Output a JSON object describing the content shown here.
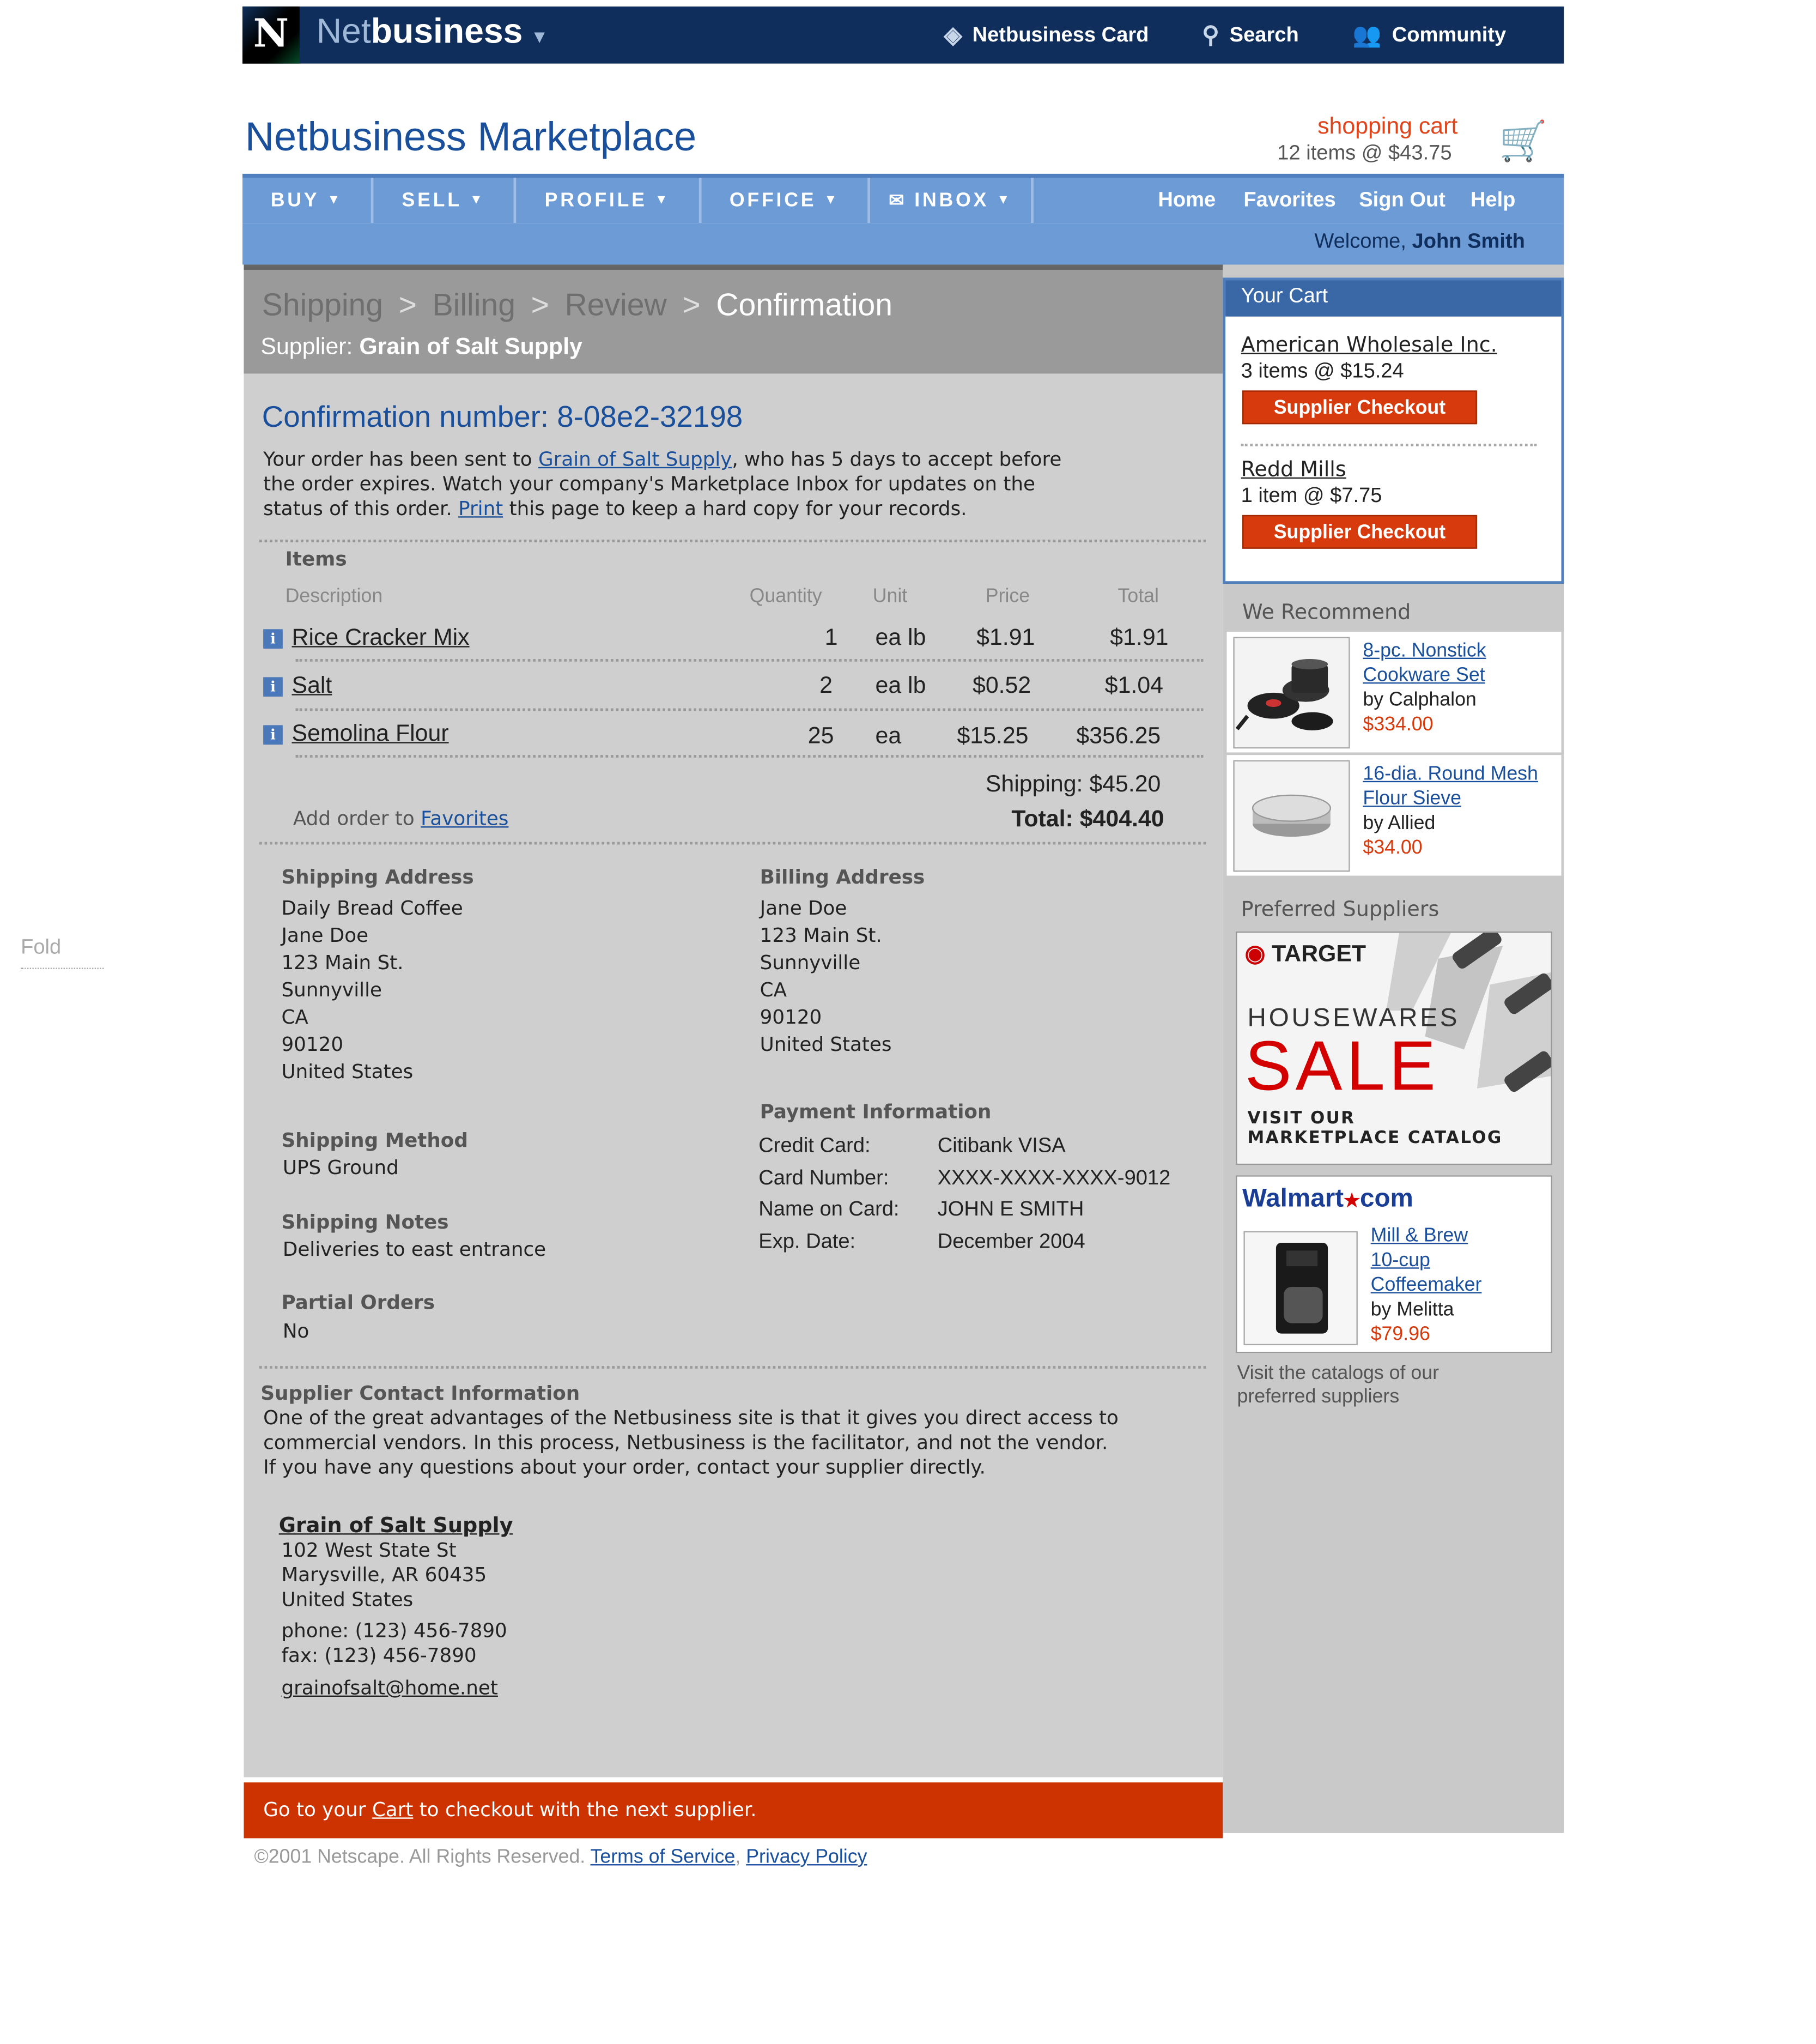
{
  "topbar": {
    "logo_letter": "N",
    "brand_light": "Net",
    "brand_bold": "business",
    "links": [
      {
        "label": "Netbusiness Card",
        "icon": "card-icon"
      },
      {
        "label": "Search",
        "icon": "search-icon"
      },
      {
        "label": "Community",
        "icon": "community-icon"
      }
    ]
  },
  "header": {
    "title": "Netbusiness Marketplace",
    "cart_label": "shopping cart",
    "cart_summary": "12 items @ $43.75"
  },
  "nav": {
    "tabs": [
      "BUY",
      "SELL",
      "PROFILE",
      "OFFICE",
      "INBOX"
    ],
    "right_links": [
      "Home",
      "Favorites",
      "Sign Out",
      "Help"
    ],
    "welcome_prefix": "Welcome,",
    "welcome_name": "John Smith"
  },
  "steps": {
    "items": [
      "Shipping",
      "Billing",
      "Review",
      "Confirmation"
    ],
    "separator": ">",
    "supplier_label": "Supplier:",
    "supplier_name": "Grain of Salt Supply"
  },
  "confirmation": {
    "title": "Confirmation number: 8-08e2-32198",
    "text_1": "Your order has been sent to ",
    "supplier_link": "Grain of Salt Supply",
    "text_2": ", who has 5 days to accept before",
    "line_2": "the order expires. Watch your company's Marketplace Inbox for updates on the",
    "line_3a": "status of this order. ",
    "print_link": "Print",
    "line_3b": " this page to keep a hard copy for your records."
  },
  "items": {
    "heading": "Items",
    "columns": [
      "Description",
      "Quantity",
      "Unit",
      "Price",
      "Total"
    ],
    "rows": [
      {
        "desc": "Rice Cracker Mix",
        "qty": "1",
        "unit": "ea lb",
        "price": "$1.91",
        "total": "$1.91"
      },
      {
        "desc": "Salt",
        "qty": "2",
        "unit": "ea lb",
        "price": "$0.52",
        "total": "$1.04"
      },
      {
        "desc": "Semolina Flour",
        "qty": "25",
        "unit": "ea",
        "price": "$15.25",
        "total": "$356.25"
      }
    ],
    "shipping": "Shipping: $45.20",
    "total": "Total: $404.40",
    "add_to_prefix": "Add order to",
    "favorites_link": "Favorites"
  },
  "shipping_address": {
    "heading": "Shipping Address",
    "lines": [
      "Daily Bread Coffee",
      "Jane Doe",
      "123 Main St.",
      "Sunnyville",
      "CA",
      "90120",
      "United States"
    ]
  },
  "billing_address": {
    "heading": "Billing Address",
    "lines": [
      "Jane Doe",
      "123 Main St.",
      "Sunnyville",
      "CA",
      "90120",
      "United States"
    ]
  },
  "shipping_method": {
    "heading": "Shipping Method",
    "value": "UPS Ground"
  },
  "shipping_notes": {
    "heading": "Shipping Notes",
    "value": "Deliveries to east entrance"
  },
  "partial_orders": {
    "heading": "Partial Orders",
    "value": "No"
  },
  "payment": {
    "heading": "Payment Information",
    "rows": [
      {
        "label": "Credit Card:",
        "value": "Citibank VISA"
      },
      {
        "label": "Card Number:",
        "value": "XXXX-XXXX-XXXX-9012"
      },
      {
        "label": "Name on Card:",
        "value": "JOHN E SMITH"
      },
      {
        "label": "Exp. Date:",
        "value": "December 2004"
      }
    ]
  },
  "supplier_contact": {
    "heading": "Supplier Contact Information",
    "lines": [
      "One of the great advantages of the Netbusiness site is that it gives you direct access to",
      "commercial vendors. In this process, Netbusiness is the facilitator, and not the vendor.",
      "If you have any questions about your order, contact your supplier directly."
    ],
    "name": "Grain of Salt Supply",
    "address": [
      "102 West State St",
      "Marysville, AR 60435",
      "United States"
    ],
    "phone": "phone: (123) 456-7890",
    "fax": "fax: (123) 456-7890",
    "email": "grainofsalt@home.net"
  },
  "footer_bar": {
    "prefix": "Go to your ",
    "link": "Cart",
    "suffix": " to checkout with the next supplier."
  },
  "fold_label": "Fold",
  "copyright": {
    "text": "©2001 Netscape. All Rights Reserved.",
    "terms": "Terms of Service",
    "sep": ",",
    "privacy": "Privacy Policy"
  },
  "your_cart": {
    "heading": "Your Cart",
    "suppliers": [
      {
        "name": "American Wholesale Inc.",
        "summary": "3 items @ $15.24",
        "button": "Supplier Checkout"
      },
      {
        "name": "Redd Mills",
        "summary": "1 item @ $7.75",
        "button": "Supplier Checkout"
      }
    ]
  },
  "recommend": {
    "heading": "We Recommend",
    "items": [
      {
        "name_1": "8-pc. Nonstick",
        "name_2": "Cookware Set",
        "by": "by Calphalon",
        "price": "$334.00"
      },
      {
        "name_1": "16-dia. Round Mesh",
        "name_2": "Flour Sieve",
        "by": "by Allied",
        "price": "$34.00"
      }
    ]
  },
  "preferred": {
    "heading": "Preferred Suppliers",
    "target_brand": "TARGET",
    "target_line1": "HOUSEWARES",
    "target_line2": "SALE",
    "target_line3": "VISIT OUR",
    "target_line4": "MARKETPLACE CATALOG",
    "walmart_brand": "Walmart",
    "walmart_star": "★",
    "walmart_com": "com",
    "walmart_item_1": "Mill & Brew",
    "walmart_item_2": "10-cup",
    "walmart_item_3": "Coffeemaker",
    "walmart_by": "by Melitta",
    "walmart_price": "$79.96",
    "visit_1": "Visit the catalogs of our",
    "visit_2": "preferred suppliers"
  },
  "colors": {
    "navy": "#0f2e5c",
    "accent": "#1a4f9c",
    "orange": "#d73a0c",
    "nav_blue": "#6d9bd6"
  }
}
